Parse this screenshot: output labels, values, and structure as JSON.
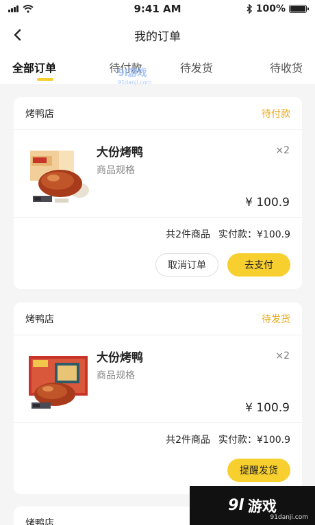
{
  "status_bar": {
    "time": "9:41 AM",
    "battery": "100%",
    "battery_level": 1.0
  },
  "nav": {
    "title": "我的订单"
  },
  "tabs": [
    {
      "label": "全部订单",
      "active": true
    },
    {
      "label": "待付款",
      "active": false
    },
    {
      "label": "待发货",
      "active": false
    },
    {
      "label": "待收货",
      "active": false
    }
  ],
  "orders": [
    {
      "shop": "烤鸭店",
      "status": "待付款",
      "product": {
        "name": "大份烤鸭",
        "spec": "商品规格",
        "qty": "×2",
        "price": "¥ 100.9"
      },
      "summary": {
        "count": "共2件商品",
        "paid": "实付款：¥100.9"
      },
      "buttons": [
        "取消订单",
        "去支付"
      ]
    },
    {
      "shop": "烤鸭店",
      "status": "待发货",
      "product": {
        "name": "大份烤鸭",
        "spec": "商品规格",
        "qty": "×2",
        "price": "¥ 100.9"
      },
      "summary": {
        "count": "共2件商品",
        "paid": "实付款：¥100.9"
      },
      "buttons": [
        "提醒发货"
      ]
    },
    {
      "shop": "烤鸭店"
    }
  ],
  "watermark": {
    "logo": "9l",
    "text": "游戏",
    "url": "91danji.com"
  },
  "colors": {
    "accent": "#f7cf2e",
    "status_text": "#e8a91b",
    "background": "#f5f5f5"
  }
}
